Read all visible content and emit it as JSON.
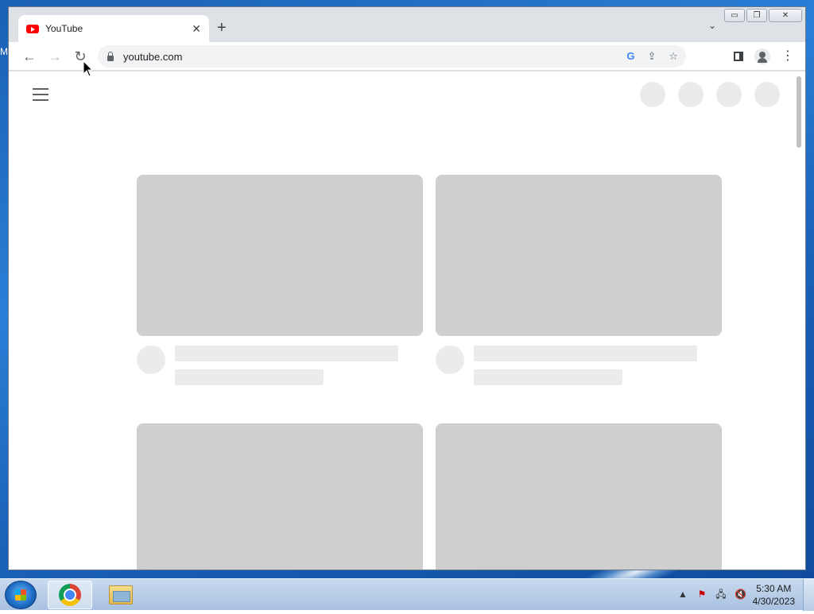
{
  "desktop": {
    "edge_letter": "M"
  },
  "browser": {
    "tab": {
      "title": "YouTube",
      "close_glyph": "✕",
      "favicon": "youtube-icon"
    },
    "new_tab_glyph": "+",
    "tab_list_glyph": "⌄",
    "window_controls": {
      "minimize": "▭",
      "maximize": "❐",
      "close": "✕"
    },
    "toolbar": {
      "back_glyph": "←",
      "forward_glyph": "→",
      "reload_glyph": "↻",
      "url": "youtube.com",
      "google_glyph": "G",
      "share_glyph": "⇪",
      "bookmark_glyph": "☆",
      "menu_glyph": "⋮"
    }
  },
  "taskbar": {
    "clock_time": "5:30 AM",
    "clock_date": "4/30/2023",
    "tray_expand_glyph": "▲"
  }
}
